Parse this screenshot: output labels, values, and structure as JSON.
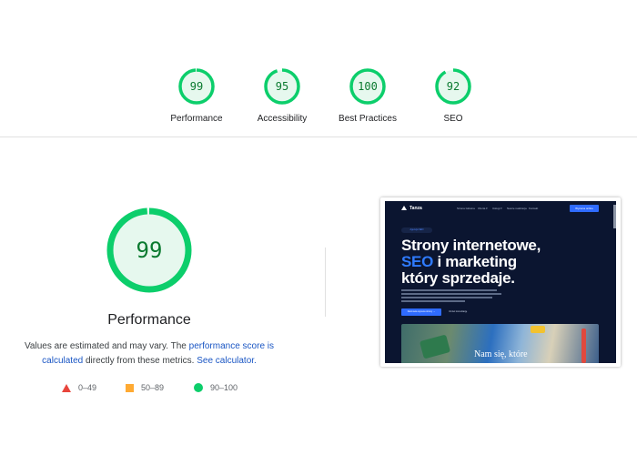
{
  "summary": {
    "gauges": [
      {
        "score": "99",
        "label": "Performance",
        "fraction": 0.99
      },
      {
        "score": "95",
        "label": "Accessibility",
        "fraction": 0.95
      },
      {
        "score": "100",
        "label": "Best Practices",
        "fraction": 1.0
      },
      {
        "score": "92",
        "label": "SEO",
        "fraction": 0.92
      }
    ]
  },
  "performance": {
    "score": "99",
    "fraction": 0.99,
    "title": "Performance",
    "desc_prefix": "Values are estimated and may vary. The ",
    "desc_link1": "performance score is calculated",
    "desc_middle": " directly from these metrics. ",
    "desc_link2": "See calculator."
  },
  "legend": {
    "fail": "0–49",
    "average": "50–89",
    "pass": "90–100"
  },
  "colors": {
    "pass": "#0cce6b",
    "pass_text": "#0a7a2f",
    "pass_bg": "#e6f8ee",
    "average": "#ffaa33",
    "fail": "#e8453c",
    "link": "#1a56c4"
  },
  "screenshot": {
    "logo_text": "Tanza",
    "nav_items": [
      "Strona Główna",
      "Oferta ▾",
      "Usługi ▾",
      "Nasze realizacje",
      "Kontakt"
    ],
    "nav_button": "Wycena online",
    "eyebrow": "Agencja SEO",
    "headline_line1": "Strony internetowe,",
    "headline_seo": "SEO",
    "headline_line2_rest": " i marketing",
    "headline_line3": "który sprzedaje.",
    "cta_primary": "Darmowa wycena strony →",
    "cta_secondary": "Umów konsultację",
    "photo_text": "Nam się, które"
  }
}
